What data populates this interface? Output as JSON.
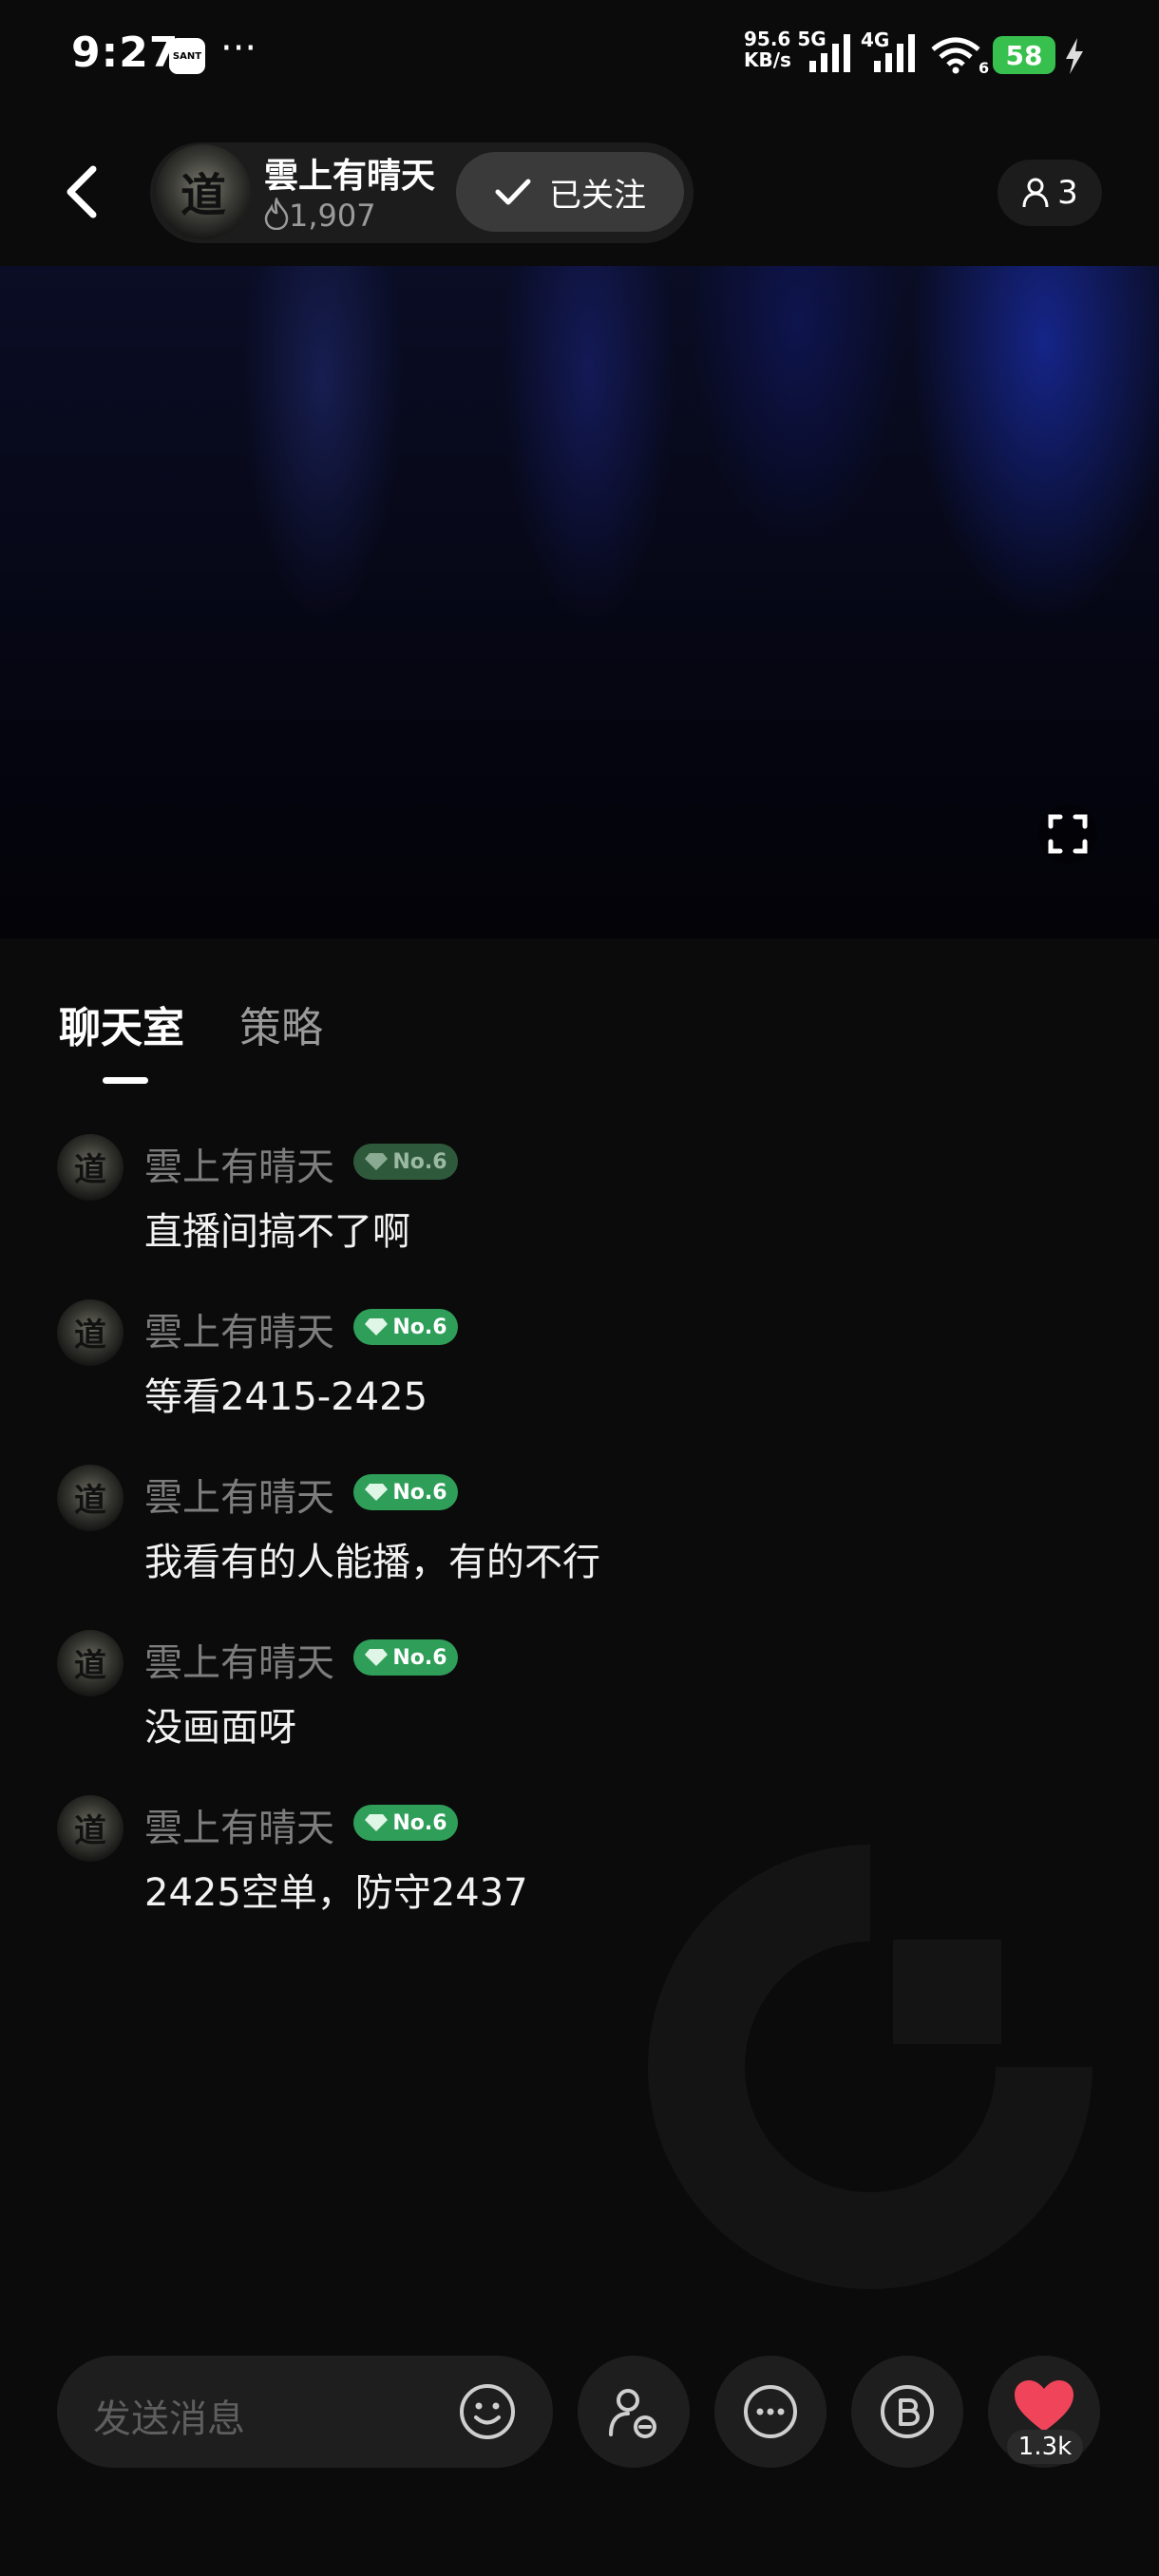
{
  "status_bar": {
    "time": "9:27",
    "app_badge": "SANT",
    "more": "···",
    "net_speed": "95.6",
    "net_unit": "KB/s",
    "net_5g": "5G",
    "net_4g": "4G",
    "wifi_label": "6",
    "battery": "58"
  },
  "header": {
    "avatar_glyph": "道",
    "host_name": "雲上有晴天",
    "heat": "1,907",
    "follow_label": "已关注",
    "viewer_count": "3"
  },
  "tabs": [
    "聊天室",
    "策略"
  ],
  "chat": {
    "messages": [
      {
        "user": "雲上有晴天",
        "level": "No.6",
        "text": "直播间搞不了啊"
      },
      {
        "user": "雲上有晴天",
        "level": "No.6",
        "text": "等看2415-2425"
      },
      {
        "user": "雲上有晴天",
        "level": "No.6",
        "text": "我看有的人能播，有的不行"
      },
      {
        "user": "雲上有晴天",
        "level": "No.6",
        "text": "没画面呀"
      },
      {
        "user": "雲上有晴天",
        "level": "No.6",
        "text": "2425空单，防守2437"
      }
    ]
  },
  "bottom": {
    "input_placeholder": "发送消息",
    "like_count": "1.3k"
  },
  "colors": {
    "background": "#0b0b0b",
    "badge_green": "#2f9e59",
    "battery_green": "#37c04d",
    "like_red": "#f0445a"
  },
  "icons": [
    "back-icon",
    "fire-icon",
    "check-icon",
    "person-icon",
    "fullscreen-icon",
    "emoji-icon",
    "person-minus-icon",
    "more-icon",
    "coin-b-icon",
    "heart-icon"
  ]
}
